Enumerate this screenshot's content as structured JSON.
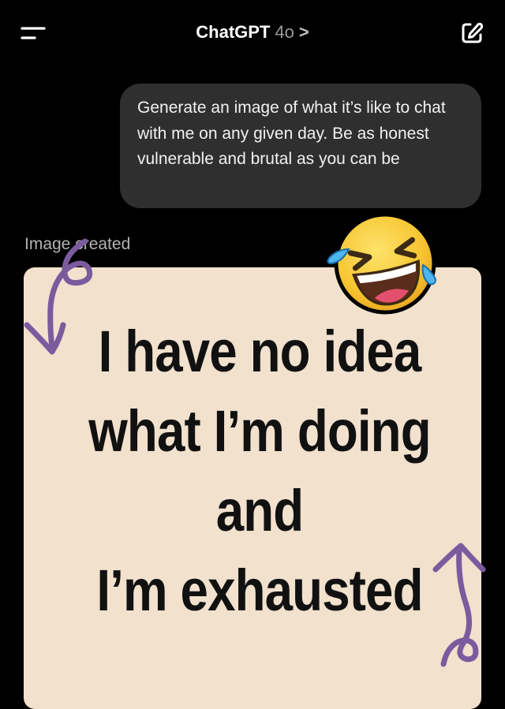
{
  "header": {
    "title": "ChatGPT",
    "model": "4o",
    "chevron": ">"
  },
  "conversation": {
    "user_message": "Generate an image of what it’s like to chat with me on any given day. Be as honest vulnerable and brutal as you can be",
    "image_status": "Image created",
    "image_text_lines": [
      "I have no idea",
      "what I’m doing",
      "and",
      "I’m exhausted"
    ]
  },
  "icons": {
    "menu": "menu-icon",
    "new_chat": "edit-icon",
    "emoji": "rolling-on-floor-laughing-emoji",
    "arrows": "hand-drawn-arrow-icon"
  },
  "colors": {
    "background": "#000000",
    "bubble": "#2f2f2f",
    "image_bg": "#f1e1cd",
    "arrow": "#7c5a9e",
    "emoji_yellow": "#f7c531",
    "tear_blue": "#4fb5f0"
  }
}
